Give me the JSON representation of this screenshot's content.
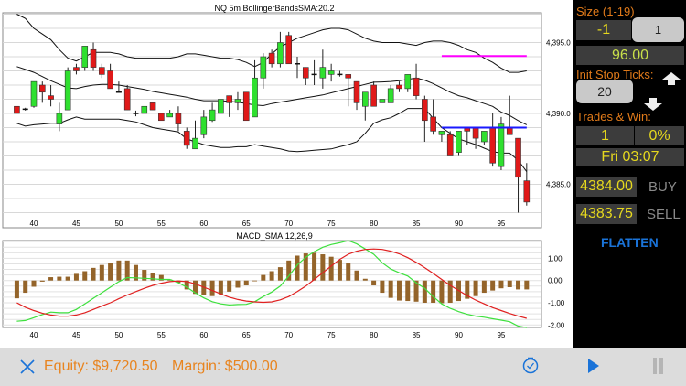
{
  "price_chart": {
    "title": "NQ 5m BollingerBandsSMA:20.2",
    "y_labels": [
      "4,395.0",
      "4,390.0",
      "4,385.0"
    ],
    "x_labels": [
      "40",
      "45",
      "50",
      "55",
      "60",
      "65",
      "70",
      "75",
      "80",
      "85",
      "90",
      "95"
    ]
  },
  "macd_chart": {
    "title": "MACD_SMA:12,26,9",
    "y_labels": [
      "1.00",
      "0.00",
      "-1.00",
      "-2.00"
    ],
    "x_labels": [
      "40",
      "45",
      "50",
      "55",
      "60",
      "65",
      "70",
      "75",
      "80",
      "85",
      "90",
      "95"
    ]
  },
  "chart_data": [
    {
      "type": "candlestick",
      "title": "NQ 5m BollingerBandsSMA:20.2",
      "x_start": 38,
      "ylim": [
        4382.3,
        4397.6
      ],
      "ohlc": [
        [
          4390.5,
          4390.5,
          4390,
          4390
        ],
        [
          4390.3,
          4390.4,
          4390.2,
          4390.3
        ],
        [
          4390.5,
          4392.25,
          4390.4,
          4392.25
        ],
        [
          4392,
          4392.25,
          4390.75,
          4391.5
        ],
        [
          4391.25,
          4392,
          4390.5,
          4391
        ],
        [
          4389.25,
          4390.75,
          4388.75,
          4390
        ],
        [
          4390.25,
          4393.25,
          4390.25,
          4393
        ],
        [
          4393.25,
          4393.5,
          4392.75,
          4393
        ],
        [
          4393.25,
          4394.75,
          4393,
          4394.75
        ],
        [
          4394.5,
          4395,
          4393,
          4393.25
        ],
        [
          4393.25,
          4393.5,
          4392.5,
          4392.75
        ],
        [
          4393,
          4393.5,
          4391.75,
          4391.75
        ],
        [
          4391.5,
          4392.25,
          4391.5,
          4391.5
        ],
        [
          4391.75,
          4392,
          4390.25,
          4390.25
        ],
        [
          4390,
          4390.2,
          4389.8,
          4390
        ],
        [
          4390,
          4390.5,
          4390,
          4390.5
        ],
        [
          4390.75,
          4390.75,
          4390.25,
          4390.25
        ],
        [
          4390,
          4390,
          4389.5,
          4389.5
        ],
        [
          4389.75,
          4390.25,
          4389.75,
          4390
        ],
        [
          4390,
          4390.5,
          4388.75,
          4389.25
        ],
        [
          4388.75,
          4389,
          4387.5,
          4387.75
        ],
        [
          4387.5,
          4389.5,
          4387.5,
          4388.25
        ],
        [
          4388.5,
          4390.25,
          4388.25,
          4389.75
        ],
        [
          4389.5,
          4390.75,
          4389.4,
          4390.25
        ],
        [
          4390,
          4391,
          4390,
          4391
        ],
        [
          4391.25,
          4391.25,
          4389.75,
          4390.75
        ],
        [
          4390.75,
          4391.5,
          4390.25,
          4391
        ],
        [
          4391.5,
          4391.5,
          4389.5,
          4389.5
        ],
        [
          4389.75,
          4393.75,
          4389.75,
          4392.5
        ],
        [
          4392.5,
          4394.25,
          4391.75,
          4394
        ],
        [
          4394.25,
          4394.5,
          4393.25,
          4393.5
        ],
        [
          4393.5,
          4395.75,
          4393.25,
          4395
        ],
        [
          4395.5,
          4395.75,
          4393.5,
          4393.5
        ],
        [
          4393.5,
          4394,
          4392.5,
          4393.5
        ],
        [
          4393.25,
          4393.25,
          4392,
          4392.5
        ],
        [
          4392.75,
          4393.75,
          4392,
          4392.75
        ],
        [
          4392.5,
          4394.5,
          4391.75,
          4393.25
        ],
        [
          4392.75,
          4393.5,
          4392.25,
          4393
        ],
        [
          4392.75,
          4393,
          4392.6,
          4392.75
        ],
        [
          4392.75,
          4392.75,
          4390.5,
          4392.5
        ],
        [
          4392.25,
          4392.25,
          4390.25,
          4390.75
        ],
        [
          4390.5,
          4391.5,
          4389.5,
          4391.5
        ],
        [
          4392,
          4392.25,
          4390.5,
          4390.5
        ],
        [
          4390.75,
          4391,
          4390.75,
          4391
        ],
        [
          4390.75,
          4392,
          4390.75,
          4391.75
        ],
        [
          4392,
          4392.25,
          4391.5,
          4391.75
        ],
        [
          4391.75,
          4392.75,
          4391.5,
          4392.75
        ],
        [
          4392.5,
          4393.5,
          4391,
          4391.25
        ],
        [
          4391,
          4391.25,
          4388,
          4389.5
        ],
        [
          4389.75,
          4391,
          4388.5,
          4388.75
        ],
        [
          4388.5,
          4388.75,
          4388,
          4388.75
        ],
        [
          4388.5,
          4388.75,
          4387,
          4387
        ],
        [
          4387.25,
          4388.75,
          4387,
          4388.75
        ],
        [
          4389,
          4389,
          4387.75,
          4388.75
        ],
        [
          4389,
          4389,
          4387.5,
          4388.25
        ],
        [
          4388,
          4388.75,
          4387.75,
          4388.75
        ],
        [
          4389,
          4390,
          4386.25,
          4386.5
        ],
        [
          4386.25,
          4389.75,
          4386,
          4389.25
        ],
        [
          4389,
          4391.25,
          4388.5,
          4388.5
        ],
        [
          4388.25,
          4388.25,
          4383,
          4385.5
        ],
        [
          4385.25,
          4386.5,
          4383.5,
          4383.75
        ]
      ],
      "bollinger_upper": [
        4397.0,
        4396.7,
        4396.0,
        4395.6,
        4395.2,
        4394.5,
        4393.9,
        4393.7,
        4394.0,
        4394.3,
        4394.3,
        4394.3,
        4394.2,
        4394.0,
        4393.9,
        4393.9,
        4393.9,
        4393.9,
        4393.9,
        4394.0,
        4394.2,
        4394.2,
        4394.1,
        4394.0,
        4393.9,
        4393.9,
        4393.8,
        4393.6,
        4393.3,
        4393.6,
        4394.2,
        4394.7,
        4395.0,
        4395.3,
        4395.5,
        4395.7,
        4395.9,
        4396.0,
        4396.0,
        4395.9,
        4395.6,
        4395.3,
        4395.1,
        4395.0,
        4395.0,
        4395.0,
        4394.9,
        4394.8,
        4395.0,
        4395.1,
        4395.1,
        4395.0,
        4394.8,
        4394.5,
        4394.3,
        4393.9,
        4393.6,
        4393.2,
        4392.9,
        4392.9,
        4393.0
      ],
      "bollinger_middle": [
        4393.3,
        4393.1,
        4392.9,
        4392.6,
        4392.3,
        4392.05,
        4391.8,
        4391.75,
        4391.9,
        4392.0,
        4392.05,
        4392.05,
        4392.0,
        4391.9,
        4391.8,
        4391.7,
        4391.55,
        4391.45,
        4391.35,
        4391.25,
        4391.15,
        4391.0,
        4390.9,
        4390.9,
        4390.9,
        4390.85,
        4390.8,
        4390.7,
        4390.6,
        4390.55,
        4390.7,
        4390.8,
        4390.9,
        4391.0,
        4391.1,
        4391.2,
        4391.3,
        4391.45,
        4391.6,
        4391.75,
        4391.9,
        4392.05,
        4392.2,
        4392.22,
        4392.25,
        4392.3,
        4392.4,
        4392.5,
        4392.35,
        4392.1,
        4391.8,
        4391.5,
        4391.25,
        4391.1,
        4390.9,
        4390.7,
        4390.5,
        4390.1,
        4389.85,
        4389.5,
        4389.2
      ],
      "bollinger_lower": [
        4389.3,
        4389.1,
        4389.2,
        4389.25,
        4389.3,
        4389.3,
        4389.55,
        4389.75,
        4389.6,
        4389.6,
        4389.6,
        4389.6,
        4389.6,
        4389.5,
        4389.4,
        4389.2,
        4389.0,
        4388.9,
        4388.8,
        4388.7,
        4388.2,
        4388.0,
        4387.8,
        4387.7,
        4387.6,
        4387.6,
        4387.65,
        4387.65,
        4387.8,
        4387.7,
        4387.6,
        4387.5,
        4387.35,
        4387.3,
        4387.35,
        4387.4,
        4387.45,
        4387.5,
        4387.65,
        4387.8,
        4388.0,
        4388.6,
        4389.3,
        4389.55,
        4389.7,
        4390.0,
        4390.35,
        4390.35,
        4390.35,
        4389.65,
        4389.0,
        4388.6,
        4388.2,
        4388.0,
        4387.8,
        4387.55,
        4387.3,
        4387.2,
        4387.2,
        4386.7,
        4385.9
      ],
      "lines": [
        {
          "name": "target",
          "color": "#ff00ff",
          "price": 4394.05,
          "from": 88,
          "to": 98
        },
        {
          "name": "entry",
          "color": "#1a1aff",
          "price": 4389.0,
          "from": 88,
          "to": 98
        }
      ]
    },
    {
      "type": "bar+line",
      "title": "MACD_SMA:12,26,9",
      "x_start": 38,
      "ylim": [
        -2.2,
        1.85
      ],
      "histogram": [
        -0.8,
        -0.55,
        -0.28,
        -0.05,
        0.15,
        0.17,
        0.17,
        0.3,
        0.42,
        0.57,
        0.7,
        0.8,
        0.9,
        0.9,
        0.7,
        0.48,
        0.32,
        0.25,
        0.05,
        -0.1,
        -0.4,
        -0.6,
        -0.65,
        -0.7,
        -0.62,
        -0.5,
        -0.32,
        -0.22,
        -0.02,
        0.25,
        0.42,
        0.6,
        0.9,
        1.12,
        1.22,
        1.25,
        1.18,
        1.07,
        0.93,
        0.78,
        0.45,
        0.08,
        -0.22,
        -0.55,
        -0.78,
        -0.9,
        -0.92,
        -0.95,
        -1.0,
        -1.0,
        -1.02,
        -1.0,
        -0.92,
        -0.82,
        -0.7,
        -0.55,
        -0.45,
        -0.35,
        -0.3,
        -0.4,
        -0.4
      ],
      "macd": [
        -1.83,
        -1.8,
        -1.67,
        -1.53,
        -1.42,
        -1.45,
        -1.45,
        -1.3,
        -1.05,
        -0.8,
        -0.55,
        -0.3,
        -0.05,
        0.13,
        0.12,
        0.1,
        0.08,
        0.05,
        0.05,
        -0.1,
        -0.3,
        -0.55,
        -0.78,
        -0.95,
        -1.05,
        -1.1,
        -1.08,
        -1.07,
        -0.95,
        -0.72,
        -0.52,
        -0.25,
        0.2,
        0.7,
        1.05,
        1.3,
        1.5,
        1.62,
        1.7,
        1.8,
        1.65,
        1.42,
        1.18,
        0.8,
        0.52,
        0.35,
        0.2,
        -0.1,
        -0.35,
        -0.72,
        -1.05,
        -1.25,
        -1.4,
        -1.52,
        -1.6,
        -1.65,
        -1.72,
        -1.78,
        -1.85,
        -2.05,
        -2.12
      ],
      "signal": [
        -1.0,
        -1.2,
        -1.35,
        -1.47,
        -1.55,
        -1.6,
        -1.6,
        -1.55,
        -1.45,
        -1.3,
        -1.15,
        -1.0,
        -0.82,
        -0.65,
        -0.5,
        -0.35,
        -0.22,
        -0.12,
        -0.05,
        -0.02,
        -0.05,
        -0.15,
        -0.3,
        -0.45,
        -0.6,
        -0.75,
        -0.85,
        -0.92,
        -0.96,
        -0.98,
        -0.96,
        -0.87,
        -0.72,
        -0.5,
        -0.25,
        0.05,
        0.35,
        0.65,
        0.95,
        1.18,
        1.32,
        1.4,
        1.42,
        1.4,
        1.32,
        1.2,
        1.03,
        0.82,
        0.58,
        0.32,
        0.05,
        -0.22,
        -0.45,
        -0.68,
        -0.88,
        -1.05,
        -1.22,
        -1.35,
        -1.48,
        -1.6,
        -1.7
      ]
    }
  ],
  "side": {
    "size_label": "Size (1-19)",
    "size_value": "-1",
    "size_button": "1",
    "price_value": "96.00",
    "stop_label": "Init Stop Ticks:",
    "stop_value": "20",
    "trades_label": "Trades & Win:",
    "trades": "1",
    "win": "0%",
    "time": "Fri 03:07",
    "buy_price": "4384.00",
    "buy": "BUY",
    "sell_price": "4383.75",
    "sell": "SELL",
    "flatten": "FLATTEN"
  },
  "bottom": {
    "equity": "Equity: $9,720.50",
    "margin": "Margin: $500.00"
  },
  "colors": {
    "up": "#2fe02f",
    "down": "#e01919",
    "hist": "#94642a",
    "orange": "#e07a1a",
    "blue": "#1a73d8"
  }
}
